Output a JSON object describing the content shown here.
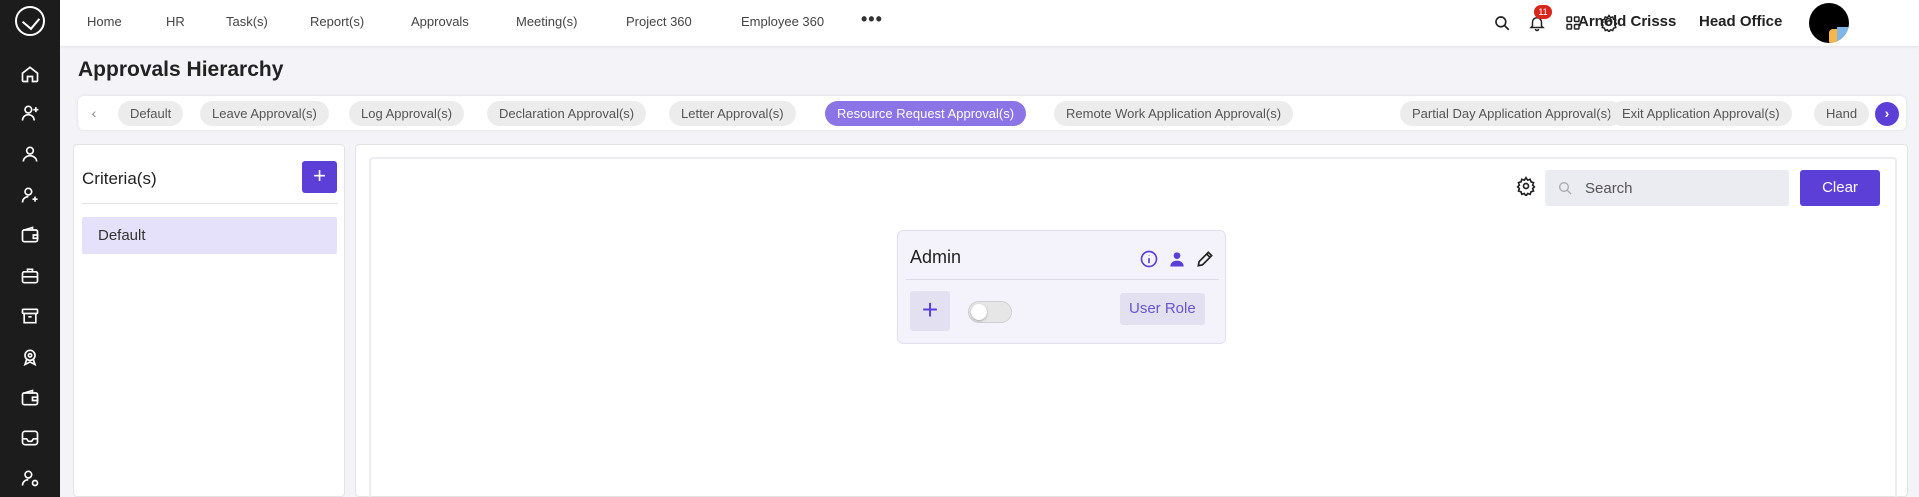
{
  "colors": {
    "accent": "#5b3fd6",
    "active_tab": "#8b75e6",
    "sidebar_bg": "#1c1c1c",
    "badge": "#d9261c"
  },
  "sidebar": {
    "logo_icon": "check-circle-icon",
    "items": [
      {
        "icon": "home-icon"
      },
      {
        "icon": "user-plus-icon"
      },
      {
        "icon": "user-icon"
      },
      {
        "icon": "user-add-icon"
      },
      {
        "icon": "wallet-icon"
      },
      {
        "icon": "briefcase-icon"
      },
      {
        "icon": "archive-icon"
      },
      {
        "icon": "badge-icon"
      },
      {
        "icon": "card-icon"
      },
      {
        "icon": "inbox-icon"
      },
      {
        "icon": "user-settings-icon"
      }
    ]
  },
  "topbar": {
    "nav": [
      "Home",
      "HR",
      "Task(s)",
      "Report(s)",
      "Approvals",
      "Meeting(s)",
      "Project 360",
      "Employee 360"
    ],
    "more_icon": "more-horizontal-icon",
    "notification_count": "11",
    "user_name": "Arnold Crisss",
    "office": "Head Office"
  },
  "page": {
    "title": "Approvals Hierarchy"
  },
  "tabs": {
    "prev": "‹",
    "next": "›",
    "items": [
      "Default",
      "Leave Approval(s)",
      "Log Approval(s)",
      "Declaration Approval(s)",
      "Letter Approval(s)",
      "Resource Request Approval(s)",
      "Remote Work Application Approval(s)",
      "Partial Day Application Approval(s)",
      "Exit Application Approval(s)",
      "Hand"
    ],
    "active": "Resource Request Approval(s)"
  },
  "criteria": {
    "title": "Criteria(s)",
    "add_label": "+",
    "items": [
      "Default"
    ]
  },
  "toolbar": {
    "search_placeholder": "Search",
    "clear_label": "Clear"
  },
  "card": {
    "title": "Admin",
    "add_label": "+",
    "role_label": "User Role",
    "toggle_on": false
  }
}
